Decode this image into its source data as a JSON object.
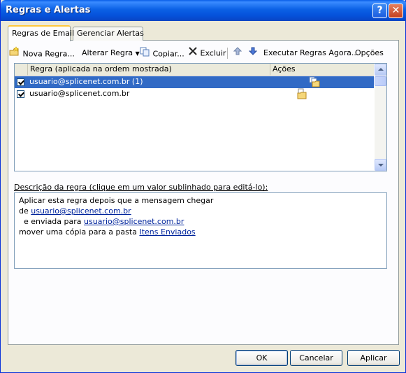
{
  "window": {
    "title": "Regras e Alertas",
    "help": "?",
    "close": "✕"
  },
  "tabs": [
    "Regras de Email",
    "Gerenciar Alertas"
  ],
  "toolbar": {
    "new_rule": "Nova Regra...",
    "change_rule": "Alterar Regra",
    "copy": "Copiar...",
    "delete": "Excluir",
    "run_rules": "Executar Regras Agora...",
    "options": "Opções"
  },
  "rules_list": {
    "columns": [
      "Regra (aplicada na ordem mostrada)",
      "Ações"
    ],
    "rows": [
      {
        "checked": true,
        "name": "usuario@splicenet.com.br (1)",
        "selected": true
      },
      {
        "checked": true,
        "name": "usuario@splicenet.com.br",
        "selected": false
      }
    ]
  },
  "description": {
    "label": "Descrição da regra (clique em um valor sublinhado para editá-lo):",
    "line1": "Aplicar esta regra depois que a mensagem chegar",
    "line2_prefix": "de ",
    "line2_link": "usuario@splicenet.com.br",
    "line3_prefix": "  e enviada para ",
    "line3_link": "usuario@splicenet.com.br",
    "line4_prefix": "mover uma cópia para a pasta ",
    "line4_link": "Itens Enviados"
  },
  "buttons": {
    "ok": "OK",
    "cancel": "Cancelar",
    "apply": "Aplicar"
  }
}
